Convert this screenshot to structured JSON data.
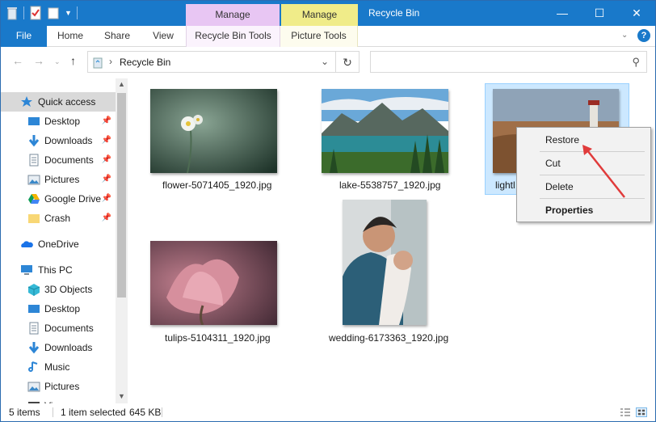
{
  "window": {
    "title": "Recycle Bin",
    "minimize": "—",
    "maximize": "☐",
    "close": "✕"
  },
  "context_tabs": {
    "manage_a": "Manage",
    "manage_b": "Manage"
  },
  "ribbon": {
    "file": "File",
    "home": "Home",
    "share": "Share",
    "view": "View",
    "recycle_bin_tools": "Recycle Bin Tools",
    "picture_tools": "Picture Tools"
  },
  "address": {
    "path": "Recycle Bin",
    "search_placeholder": ""
  },
  "nav": {
    "items": [
      {
        "label": "Quick access",
        "icon": "star-icon"
      },
      {
        "label": "Desktop",
        "icon": "desktop-icon"
      },
      {
        "label": "Downloads",
        "icon": "download-icon"
      },
      {
        "label": "Documents",
        "icon": "documents-icon"
      },
      {
        "label": "Pictures",
        "icon": "pictures-icon"
      },
      {
        "label": "Google Drive",
        "icon": "google-drive-icon"
      },
      {
        "label": "Crash",
        "icon": "folder-icon"
      },
      {
        "label": "OneDrive",
        "icon": "onedrive-icon"
      },
      {
        "label": "This PC",
        "icon": "computer-icon"
      },
      {
        "label": "3D Objects",
        "icon": "cube-icon"
      },
      {
        "label": "Desktop",
        "icon": "desktop-icon"
      },
      {
        "label": "Documents",
        "icon": "documents-icon"
      },
      {
        "label": "Downloads",
        "icon": "download-icon"
      },
      {
        "label": "Music",
        "icon": "music-icon"
      },
      {
        "label": "Pictures",
        "icon": "pictures-icon"
      },
      {
        "label": "Vi",
        "icon": "videos-icon"
      }
    ]
  },
  "files": [
    {
      "name": "flower-5071405_1920.jpg"
    },
    {
      "name": "lake-5538757_1920.jpg"
    },
    {
      "name": "lightl"
    },
    {
      "name": "tulips-5104311_1920.jpg"
    },
    {
      "name": "wedding-6173363_1920.jpg"
    }
  ],
  "context_menu": {
    "restore": "Restore",
    "cut": "Cut",
    "delete": "Delete",
    "properties": "Properties"
  },
  "status": {
    "item_count": "5 items",
    "selection": "1 item selected",
    "size": "645 KB"
  },
  "colors": {
    "titlebar": "#1979ca",
    "manage_a": "#e8c6f3",
    "manage_b": "#f0ec89",
    "selection": "#cce8ff",
    "arrow": "#e03b3b"
  }
}
